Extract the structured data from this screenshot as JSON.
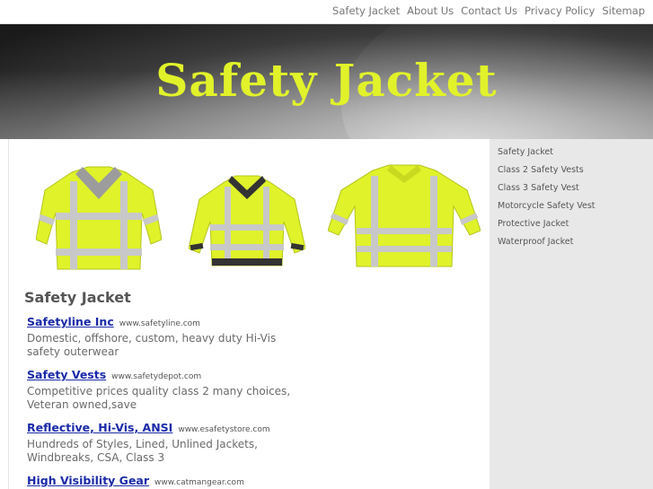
{
  "topnav": {
    "links": [
      "Safety Jacket",
      "About Us",
      "Contact Us",
      "Privacy Policy",
      "Sitemap"
    ]
  },
  "banner": {
    "title": "Safety Jacket"
  },
  "sidebar": {
    "items": [
      "Safety Jacket",
      "Class 2 Safety Vests",
      "Class 3 Safety Vest",
      "Motorcycle Safety Vest",
      "Protective Jacket",
      "Waterproof Jacket"
    ]
  },
  "main": {
    "heading": "Safety Jacket",
    "ads": [
      {
        "title": "Safetyline Inc",
        "url": "www.safetyline.com",
        "desc": "Domestic, offshore, custom, heavy duty Hi-Vis safety outerwear"
      },
      {
        "title": "Safety Vests",
        "url": "www.safetydepot.com",
        "desc": "Competitive prices quality class 2 many choices, Veteran owned,save"
      },
      {
        "title": "Reflective, Hi-Vis, ANSI",
        "url": "www.esafetystore.com",
        "desc": "Hundreds of Styles, Lined, Unlined Jackets, Windbreaks, CSA, Class 3"
      },
      {
        "title": "High Visibility Gear",
        "url": "www.catmangear.com",
        "desc": ""
      }
    ]
  },
  "colors": {
    "title_yellow": "#e1f22a",
    "jacket_yellow": "#dff22a",
    "link_blue": "#1a2aa8",
    "sidebar_bg": "#e8e8e8"
  },
  "icons": [
    "jacket-image-1",
    "jacket-image-2",
    "jacket-image-3"
  ]
}
